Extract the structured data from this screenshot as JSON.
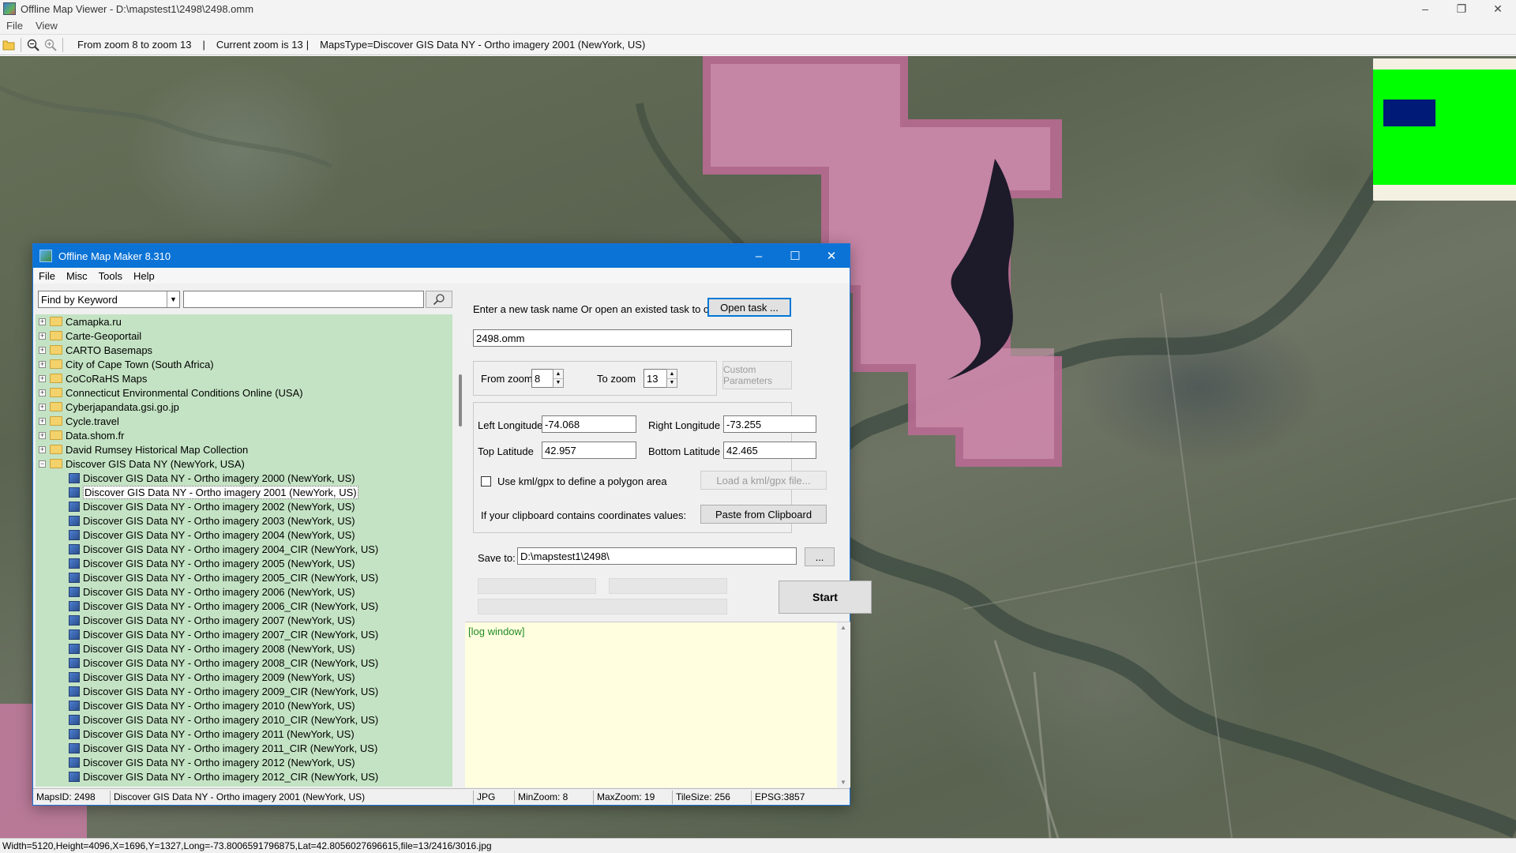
{
  "window": {
    "title": "Offline Map Viewer - D:\\mapstest1\\2498\\2498.omm"
  },
  "menu": [
    "File",
    "View"
  ],
  "toolbar": {
    "zoom_range": "From zoom 8 to zoom 13",
    "current_zoom": "Current zoom is 13",
    "maps_type": "MapsType=Discover GIS Data NY - Ortho imagery 2001 (NewYork, US)",
    "sep": "|"
  },
  "status": "Width=5120,Height=4096,X=1696,Y=1327,Long=-73.8006591796875,Lat=42.8056027696615,file=13/2416/3016.jpg",
  "dialog": {
    "title": "Offline Map Maker 8.310",
    "menu": [
      "File",
      "Misc",
      "Tools",
      "Help"
    ],
    "find_combo": "Find by Keyword",
    "tree_folders_top": [
      "Camapka.ru",
      "Carte-Geoportail",
      "CARTO Basemaps",
      "City of Cape Town (South Africa)",
      "CoCoRaHS Maps",
      "Connecticut Environmental Conditions Online (USA)",
      "Cyberjapandata.gsi.go.jp",
      "Cycle.travel",
      "Data.shom.fr",
      "David Rumsey Historical Map Collection"
    ],
    "tree_open_folder": "Discover GIS Data NY (NewYork, USA)",
    "tree_children": [
      "Discover GIS Data NY - Ortho imagery 2000 (NewYork, US)",
      "Discover GIS Data NY - Ortho imagery 2001 (NewYork, US)",
      "Discover GIS Data NY - Ortho imagery 2002 (NewYork, US)",
      "Discover GIS Data NY - Ortho imagery 2003 (NewYork, US)",
      "Discover GIS Data NY - Ortho imagery 2004 (NewYork, US)",
      "Discover GIS Data NY - Ortho imagery 2004_CIR (NewYork, US)",
      "Discover GIS Data NY - Ortho imagery 2005 (NewYork, US)",
      "Discover GIS Data NY - Ortho imagery 2005_CIR (NewYork, US)",
      "Discover GIS Data NY - Ortho imagery 2006 (NewYork, US)",
      "Discover GIS Data NY - Ortho imagery 2006_CIR (NewYork, US)",
      "Discover GIS Data NY - Ortho imagery 2007 (NewYork, US)",
      "Discover GIS Data NY - Ortho imagery 2007_CIR (NewYork, US)",
      "Discover GIS Data NY - Ortho imagery 2008 (NewYork, US)",
      "Discover GIS Data NY - Ortho imagery 2008_CIR (NewYork, US)",
      "Discover GIS Data NY - Ortho imagery 2009 (NewYork, US)",
      "Discover GIS Data NY - Ortho imagery 2009_CIR (NewYork, US)",
      "Discover GIS Data NY - Ortho imagery 2010 (NewYork, US)",
      "Discover GIS Data NY - Ortho imagery 2010_CIR (NewYork, US)",
      "Discover GIS Data NY - Ortho imagery 2011 (NewYork, US)",
      "Discover GIS Data NY - Ortho imagery 2011_CIR (NewYork, US)",
      "Discover GIS Data NY - Ortho imagery 2012 (NewYork, US)",
      "Discover GIS Data NY - Ortho imagery 2012_CIR (NewYork, US)"
    ],
    "selected_child_index": 1,
    "task_prompt": "Enter a new task name Or open an existed task to continue:",
    "open_task": "Open task ...",
    "task_name": "2498.omm",
    "from_zoom_label": "From zoom",
    "from_zoom": "8",
    "to_zoom_label": "To zoom",
    "to_zoom": "13",
    "custom_params": "Custom Parameters",
    "left_lon_label": "Left Longitude",
    "left_lon": "-74.068",
    "right_lon_label": "Right Longitude",
    "right_lon": "-73.255",
    "top_lat_label": "Top Latitude",
    "top_lat": "42.957",
    "bottom_lat_label": "Bottom Latitude",
    "bottom_lat": "42.465",
    "use_kml_label": "Use kml/gpx to define a polygon area",
    "load_kml": "Load a kml/gpx file...",
    "clipboard_prompt": "If your clipboard contains coordinates values:",
    "paste_clipboard": "Paste from Clipboard",
    "save_to_label": "Save to:",
    "save_to": "D:\\mapstest1\\2498\\",
    "browse": "...",
    "start": "Start",
    "log": "[log window]",
    "status": {
      "maps_id": "MapsID: 2498",
      "name": "Discover GIS Data NY - Ortho imagery 2001 (NewYork, US)",
      "format": "JPG",
      "min_zoom": "MinZoom: 8",
      "max_zoom": "MaxZoom: 19",
      "tile_size": "TileSize: 256",
      "epsg": "EPSG:3857"
    }
  }
}
